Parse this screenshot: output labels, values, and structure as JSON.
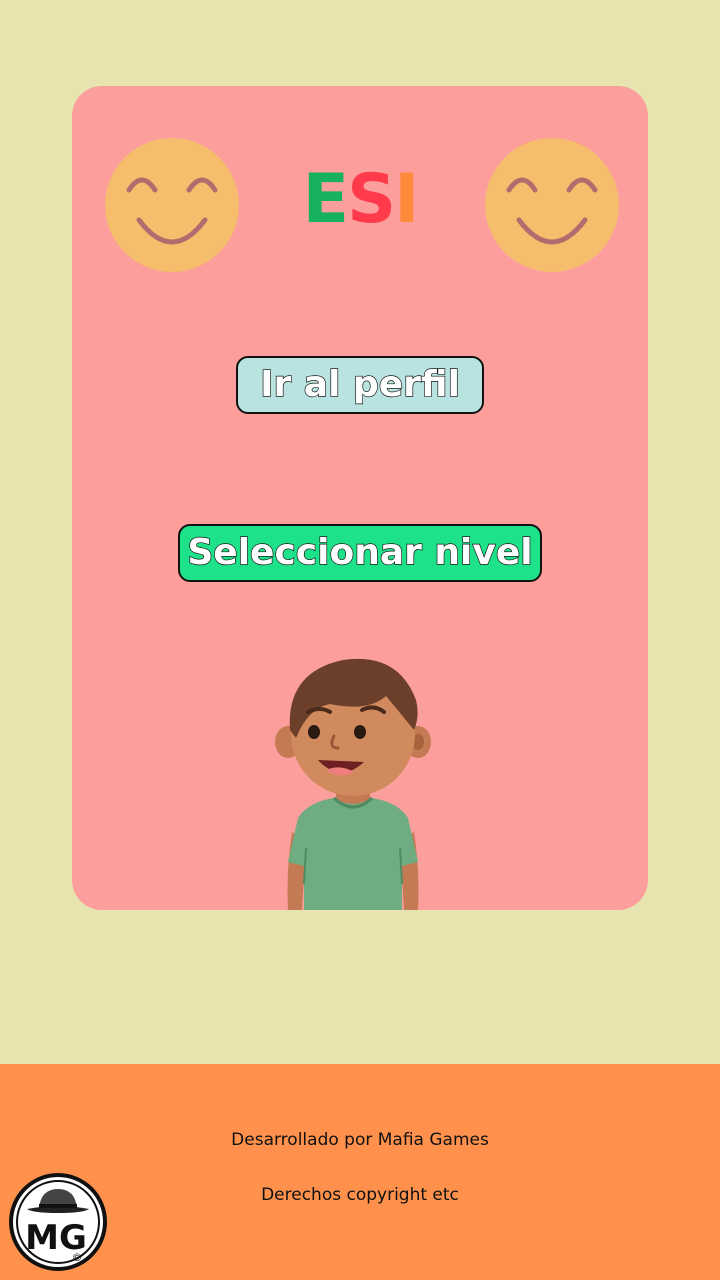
{
  "app": {
    "title_letters": [
      {
        "char": "E",
        "color": "#17b15f"
      },
      {
        "char": "S",
        "color": "#ff3a4a"
      },
      {
        "char": "I",
        "color": "#ff8a3c"
      }
    ]
  },
  "menu": {
    "profile_label": "Ir al perfil",
    "level_label": "Seleccionar nivel"
  },
  "footer": {
    "developer_text": "Desarrollado por Mafia Games",
    "copyright_text": "Derechos copyright etc",
    "logo_text": "MG",
    "logo_mark": "©"
  },
  "colors": {
    "background": "#e7e4b0",
    "card": "#fb9e9c",
    "smiley_face": "#f6bd6d",
    "smiley_features": "#b36c6d",
    "profile_button": "#b9e3e1",
    "level_button": "#1ee289",
    "footer": "#ff914d"
  },
  "icons": {
    "smiley": "smiley-face-icon",
    "character": "boy-character-illustration",
    "logo": "mafia-games-logo"
  }
}
